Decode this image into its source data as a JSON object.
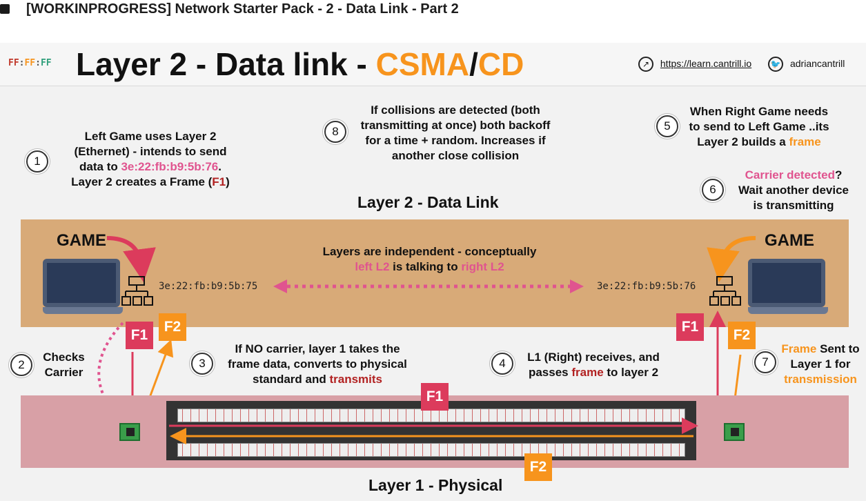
{
  "video_title": "[WORKINPROGRESS] Network Starter Pack - 2 - Data Link - Part 2",
  "logo": {
    "parts": [
      "FF",
      ":",
      "FF",
      ":",
      "FF"
    ]
  },
  "slide_title": {
    "main": "Layer 2 - Data link - ",
    "csma": "CSMA",
    "slash": "/",
    "cd": "CD"
  },
  "links": {
    "website": "https://learn.cantrill.io",
    "twitter": "adriancantrill"
  },
  "steps": {
    "s1": {
      "num": "1",
      "l1": "Left Game uses Layer 2",
      "l2": "(Ethernet) - intends to send",
      "l3a": "data to ",
      "mac": "3e:22:fb:b9:5b:76",
      "l3b": ".",
      "l4a": "Layer 2 creates a Frame (",
      "f1": "F1",
      "l4b": ")"
    },
    "s2": {
      "num": "2",
      "l1": "Checks",
      "l2": "Carrier"
    },
    "s3": {
      "num": "3",
      "l1": "If NO carrier, layer 1 takes the",
      "l2": "frame data, converts to physical",
      "l3a": "standard and ",
      "l3b": "transmits"
    },
    "s4": {
      "num": "4",
      "l1": "L1 (Right) receives, and",
      "l2a": "passes ",
      "l2b": "frame",
      "l2c": " to layer 2"
    },
    "s5": {
      "num": "5",
      "l1": "When Right Game needs",
      "l2": "to send to Left Game ..its",
      "l3a": "Layer 2 builds a ",
      "l3b": "frame"
    },
    "s6": {
      "num": "6",
      "l1a": "Carrier detected",
      "l1b": "?",
      "l2": "Wait another device",
      "l3": "is transmitting"
    },
    "s7": {
      "num": "7",
      "l1a": "Frame",
      "l1b": " Sent to",
      "l2": "Layer 1 for",
      "l3": "transmission"
    },
    "s8": {
      "num": "8",
      "l1": "If collisions are detected (both",
      "l2": "transmitting at once) both backoff",
      "l3": "for a time + random. Increases if",
      "l4": "another close collision"
    }
  },
  "layer2_label": "Layer 2 - Data Link",
  "layer1_label": "Layer 1 - Physical",
  "independent": {
    "l1": "Layers are independent - conceptually",
    "l2a": "left L2",
    "l2b": " is talking to ",
    "l2c": "right L2"
  },
  "mac_left": "3e:22:fb:b9:5b:75",
  "mac_right": "3e:22:fb:b9:5b:76",
  "game_left": "GAME",
  "game_right": "GAME",
  "badges": {
    "f1": "F1",
    "f2": "F2"
  },
  "colors": {
    "orange": "#f7941d",
    "pink": "#e0548f",
    "f1_red": "#dc3b5c",
    "layer2_band": "#d8aa78",
    "layer1_band": "#d8a0a6"
  },
  "icons": [
    "play-icon",
    "compass-icon",
    "twitter-icon",
    "network-icon",
    "nic-icon",
    "laptop-icon"
  ]
}
